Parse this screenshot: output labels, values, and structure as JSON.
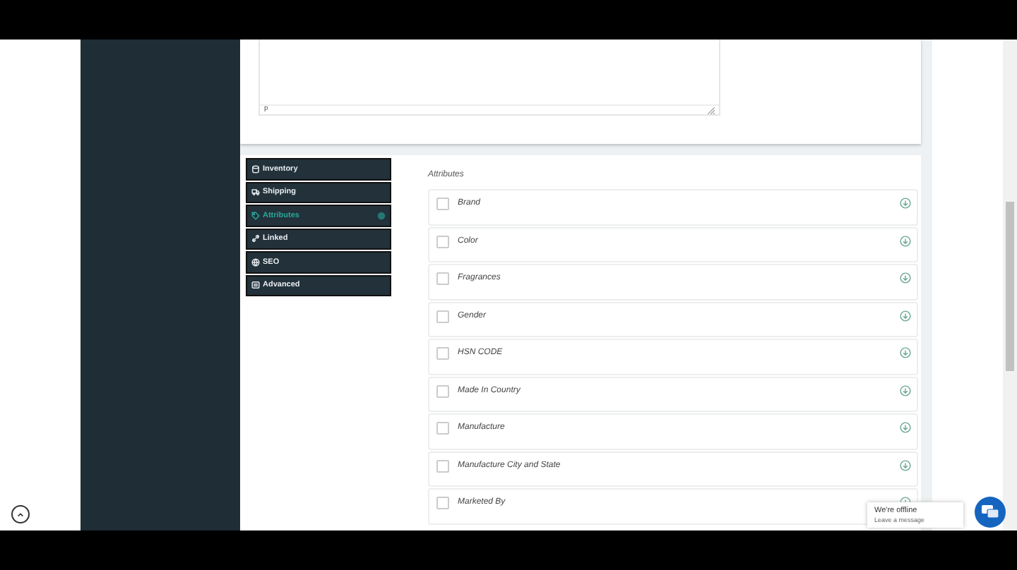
{
  "editor": {
    "path": "p"
  },
  "tabs": [
    {
      "label": "Inventory",
      "selected": false
    },
    {
      "label": "Shipping",
      "selected": false
    },
    {
      "label": "Attributes",
      "selected": true
    },
    {
      "label": "Linked",
      "selected": false
    },
    {
      "label": "SEO",
      "selected": false
    },
    {
      "label": "Advanced",
      "selected": false
    }
  ],
  "attributes": {
    "title": "Attributes",
    "items": [
      {
        "label": "Brand",
        "checked": false
      },
      {
        "label": "Color",
        "checked": false
      },
      {
        "label": "Fragrances",
        "checked": false
      },
      {
        "label": "Gender",
        "checked": false
      },
      {
        "label": "HSN CODE",
        "checked": false
      },
      {
        "label": "Made In Country",
        "checked": false
      },
      {
        "label": "Manufacture",
        "checked": false
      },
      {
        "label": "Manufacture City and State",
        "checked": false
      },
      {
        "label": "Marketed By",
        "checked": false
      }
    ]
  },
  "chat": {
    "title": "We're offline",
    "subtitle": "Leave a message"
  }
}
